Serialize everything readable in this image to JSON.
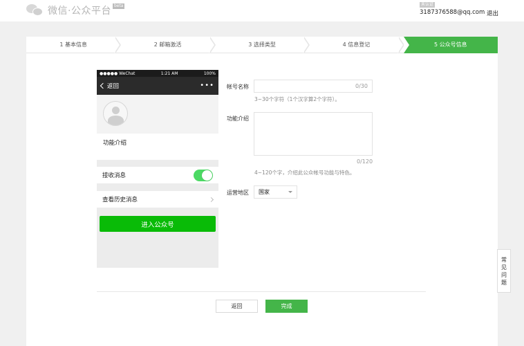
{
  "header": {
    "logo_text": "微信·公众平台",
    "beta_label": "beta",
    "account_tag": "未认证",
    "account_email": "3187376588@qq.com",
    "logout_label": "退出"
  },
  "steps": [
    {
      "label": "1 基本信息"
    },
    {
      "label": "2 邮箱激活"
    },
    {
      "label": "3 选择类型"
    },
    {
      "label": "4 信息登记"
    },
    {
      "label": "5 公众号信息"
    }
  ],
  "active_step": 5,
  "phone": {
    "carrier": "●●●●● WeChat",
    "time": "1:21 AM",
    "battery": "100%",
    "back_label": "返回",
    "more_glyph": "•••",
    "intro_label": "功能介绍",
    "receive_msg_label": "接收消息",
    "receive_msg_on": true,
    "history_label": "查看历史消息",
    "enter_button": "进入公众号"
  },
  "form": {
    "name_label": "帐号名称",
    "name_value": "",
    "name_counter": "0/30",
    "name_hint": "3~30个字符（1个汉字算2个字符）。",
    "intro_label": "功能介绍",
    "intro_value": "",
    "intro_counter": "0/120",
    "intro_hint": "4~120个字，介绍此公众帐号功能与特色。",
    "region_label": "运营地区",
    "region_value": "国家"
  },
  "buttons": {
    "back_label": "返回",
    "done_label": "完成"
  },
  "faq": {
    "chars": [
      "常",
      "见",
      "问",
      "题"
    ]
  },
  "colors": {
    "accent": "#44b549",
    "enter_button": "#09bb07",
    "toggle_on": "#4cd964"
  }
}
